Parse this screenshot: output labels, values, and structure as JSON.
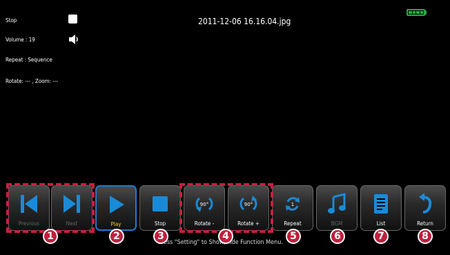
{
  "file_name": "2011-12-06 16.16.04.jpg",
  "status": {
    "playback": "Stop",
    "volume": "Volume : 19",
    "repeat": "Repeat : Sequence",
    "rotate_zoom": "Rotate: --- , Zoom: ---"
  },
  "battery_color": "#1fae4a",
  "buttons": {
    "previous": "Previous",
    "next": "Next",
    "play": "Play",
    "stop": "Stop",
    "rotate_minus": "Rotate -",
    "rotate_plus": "Rotate +",
    "repeat": "Repeat",
    "bgm": "BGM",
    "list": "List",
    "return": "Return"
  },
  "rotate_icon_text": {
    "minus": "90°",
    "plus": "90°"
  },
  "repeat_icon_text": "1",
  "callouts": [
    "1",
    "2",
    "3",
    "4",
    "5",
    "6",
    "7",
    "8"
  ],
  "hint": "Press \"Setting\" to Show/Hide Function Menu.",
  "colors": {
    "highlight": "#c62040",
    "active_border": "#1b7bd6",
    "play_label": "#ffd21e"
  }
}
